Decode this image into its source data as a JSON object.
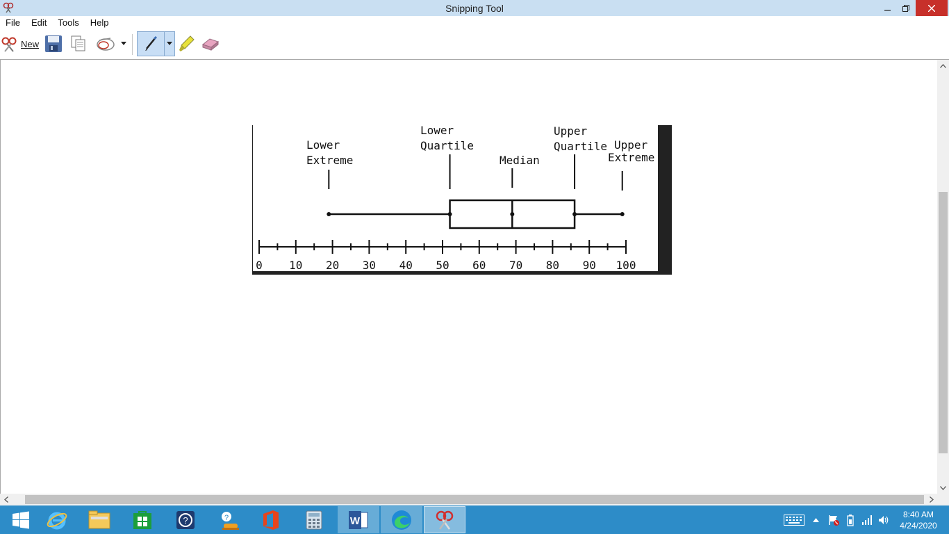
{
  "window": {
    "title": "Snipping Tool"
  },
  "menu": {
    "items": [
      "File",
      "Edit",
      "Tools",
      "Help"
    ]
  },
  "toolbar": {
    "new_label": "New"
  },
  "capture": {
    "labels": {
      "lower_extreme": [
        "Lower",
        "Extreme"
      ],
      "lower_quartile": [
        "Lower",
        "Quartile"
      ],
      "median": "Median",
      "upper_quartile": [
        "Upper",
        "Quartile"
      ],
      "upper_extreme": [
        "Upper",
        "Extreme"
      ]
    },
    "tick_labels": [
      "0",
      "10",
      "20",
      "30",
      "40",
      "50",
      "60",
      "70",
      "80",
      "90",
      "100"
    ]
  },
  "chart_data": {
    "type": "box",
    "min": 19,
    "q1": 52,
    "median": 69,
    "q3": 86,
    "max": 99,
    "xlim": [
      0,
      100
    ],
    "tick_step_major": 10,
    "tick_step_minor": 5
  },
  "taskbar": {
    "apps": [
      "start-icon",
      "internet-explorer-icon",
      "file-explorer-icon",
      "store-icon",
      "help-icon",
      "support-icon",
      "office-icon",
      "calculator-icon",
      "word-icon",
      "edge-icon",
      "snipping-tool-icon"
    ]
  },
  "clock": {
    "time": "8:40 AM",
    "date": "4/24/2020"
  }
}
